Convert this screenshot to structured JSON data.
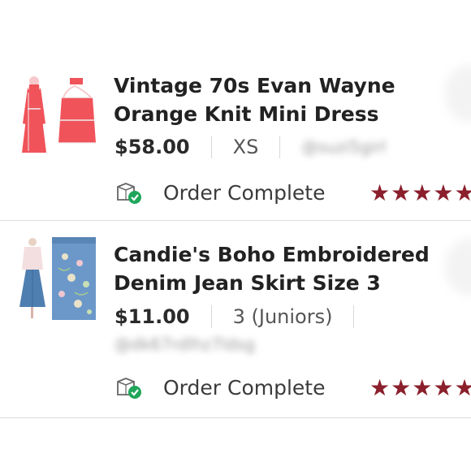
{
  "orders": [
    {
      "title": "Vintage 70s Evan Wayne Orange Knit Mini Dress",
      "price": "$58.00",
      "size": "XS",
      "seller_handle": "@suzi5girl",
      "status": "Order Complete",
      "rating": 5,
      "stars": "★★★★★",
      "product_image": "orange-knit-mini-dress",
      "status_icon": "package-check-icon"
    },
    {
      "title": "Candie's Boho Embroidered Denim Jean Skirt Size 3",
      "price": "$11.00",
      "size": "3 (Juniors)",
      "seller_handle": "@dk67rdlhz7ldsg",
      "status": "Order Complete",
      "rating": 5,
      "stars": "★★★★★",
      "product_image": "embroidered-denim-skirt",
      "status_icon": "package-check-icon"
    }
  ],
  "colors": {
    "star": "#8b1f2c",
    "check_badge": "#1fa65a",
    "divider": "#dcdcdc",
    "title_text": "#222222",
    "dress": "#f0535a"
  }
}
